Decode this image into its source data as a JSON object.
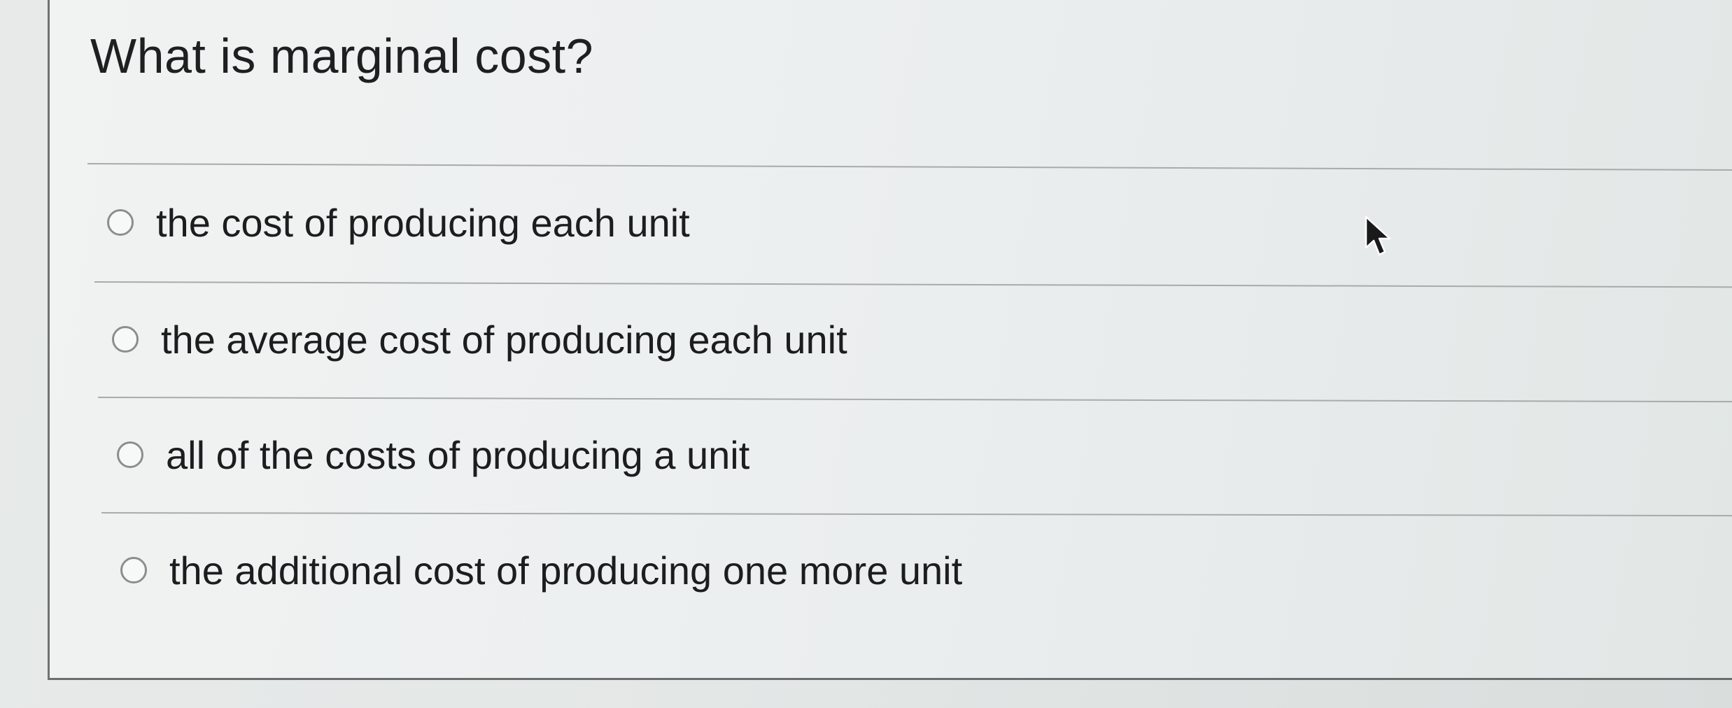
{
  "question": {
    "title": "What is marginal cost?"
  },
  "options": [
    {
      "label": "the cost of producing each unit",
      "selected": false
    },
    {
      "label": "the average cost of producing each unit",
      "selected": false
    },
    {
      "label": "all of the costs of producing a unit",
      "selected": false
    },
    {
      "label": "the additional cost of producing one more unit",
      "selected": false
    }
  ],
  "icons": {
    "radio": "radio-button-icon",
    "cursor": "mouse-pointer-icon"
  },
  "colors": {
    "text": "#1b1d1f",
    "radio_border": "#8a8e8f",
    "divider": "#a7abab"
  }
}
